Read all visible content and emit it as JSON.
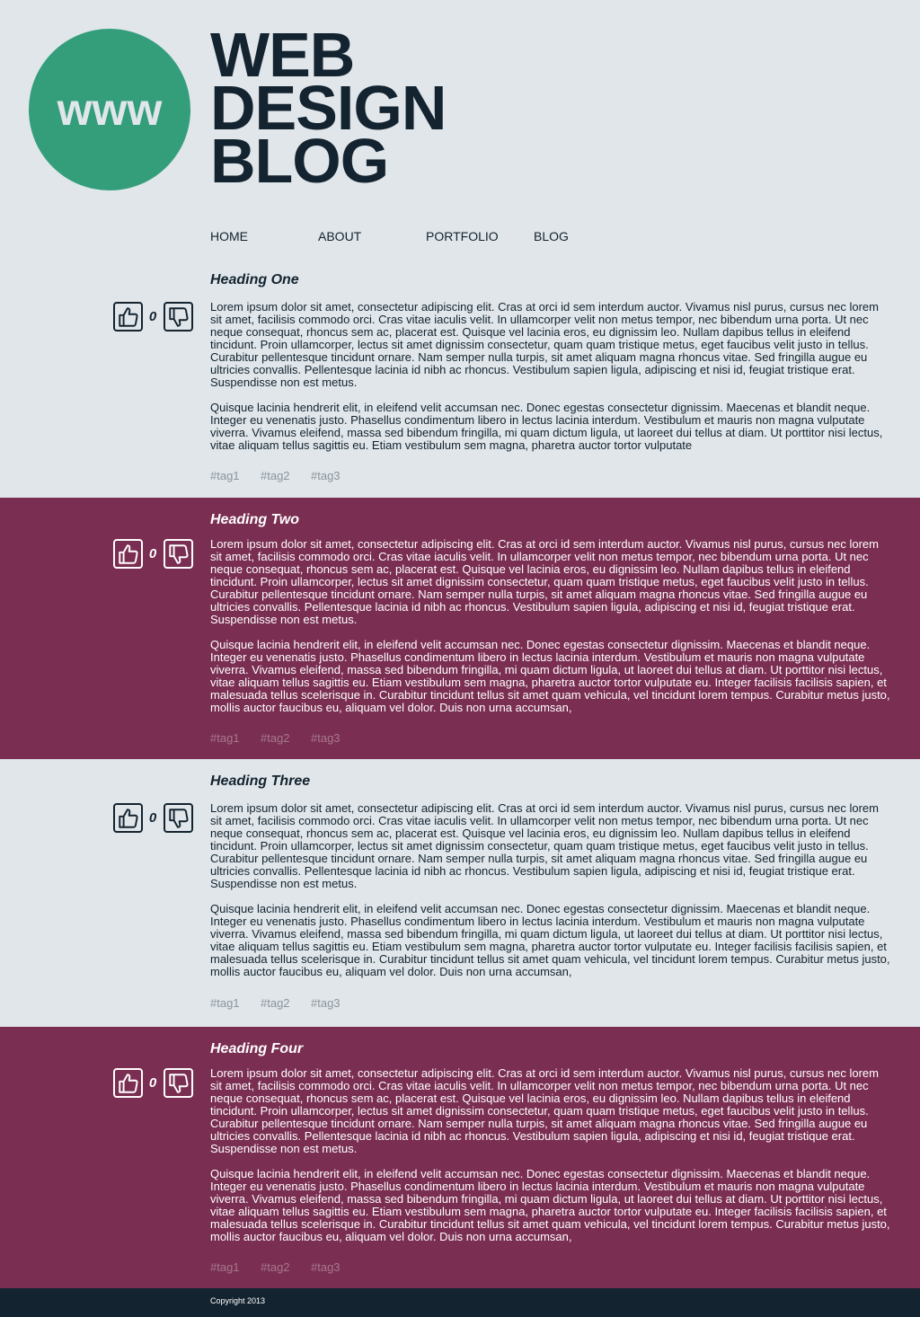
{
  "header": {
    "logo_text": "www",
    "title_lines": [
      "WEB",
      "DESIGN",
      "BLOG"
    ]
  },
  "nav": {
    "items": [
      "HOME",
      "ABOUT",
      "PORTFOLIO",
      "BLOG"
    ]
  },
  "posts": [
    {
      "heading": "Heading One",
      "votes": "0",
      "paragraphs": [
        "Lorem ipsum dolor sit amet, consectetur adipiscing elit. Cras at orci id sem interdum auctor. Vivamus nisl purus, cursus nec lorem sit amet, facilisis commodo orci. Cras vitae iaculis velit. In ullamcorper velit non metus tempor, nec bibendum urna porta. Ut nec neque consequat, rhoncus sem ac, placerat est. Quisque vel lacinia eros, eu dignissim leo. Nullam dapibus tellus in eleifend tincidunt. Proin ullamcorper, lectus sit amet dignissim consectetur, quam quam tristique metus, eget faucibus velit justo in tellus. Curabitur pellentesque tincidunt ornare. Nam semper nulla turpis, sit amet aliquam magna rhoncus vitae. Sed fringilla augue eu ultricies convallis. Pellentesque lacinia id nibh ac rhoncus. Vestibulum sapien ligula, adipiscing et nisi id, feugiat tristique erat. Suspendisse non est metus.",
        "Quisque lacinia hendrerit elit, in eleifend velit accumsan nec. Donec egestas consectetur dignissim. Maecenas et blandit neque. Integer eu venenatis justo. Phasellus condimentum libero in lectus lacinia interdum. Vestibulum et mauris non magna vulputate viverra. Vivamus eleifend, massa sed bibendum fringilla, mi quam dictum ligula, ut laoreet dui tellus at diam. Ut porttitor nisi lectus, vitae aliquam tellus sagittis eu. Etiam vestibulum sem magna, pharetra auctor tortor vulputate"
      ],
      "tags": [
        "#tag1",
        "#tag2",
        "#tag3"
      ]
    },
    {
      "heading": "Heading Two",
      "votes": "0",
      "paragraphs": [
        "Lorem ipsum dolor sit amet, consectetur adipiscing elit. Cras at orci id sem interdum auctor. Vivamus nisl purus, cursus nec lorem sit amet, facilisis commodo orci. Cras vitae iaculis velit. In ullamcorper velit non metus tempor, nec bibendum urna porta. Ut nec neque consequat, rhoncus sem ac, placerat est. Quisque vel lacinia eros, eu dignissim leo. Nullam dapibus tellus in eleifend tincidunt. Proin ullamcorper, lectus sit amet dignissim consectetur, quam quam tristique metus, eget faucibus velit justo in tellus. Curabitur pellentesque tincidunt ornare. Nam semper nulla turpis, sit amet aliquam magna rhoncus vitae. Sed fringilla augue eu ultricies convallis. Pellentesque lacinia id nibh ac rhoncus. Vestibulum sapien ligula, adipiscing et nisi id, feugiat tristique erat. Suspendisse non est metus.",
        "Quisque lacinia hendrerit elit, in eleifend velit accumsan nec. Donec egestas consectetur dignissim. Maecenas et blandit neque. Integer eu venenatis justo. Phasellus condimentum libero in lectus lacinia interdum. Vestibulum et mauris non magna vulputate viverra. Vivamus eleifend, massa sed bibendum fringilla, mi quam dictum ligula, ut laoreet dui tellus at diam. Ut porttitor nisi lectus, vitae aliquam tellus sagittis eu. Etiam vestibulum sem magna, pharetra auctor tortor vulputate eu. Integer facilisis facilisis sapien, et malesuada tellus scelerisque in. Curabitur tincidunt tellus sit amet quam vehicula, vel tincidunt lorem tempus. Curabitur metus justo, mollis auctor faucibus eu, aliquam vel dolor. Duis non urna accumsan,"
      ],
      "tags": [
        "#tag1",
        "#tag2",
        "#tag3"
      ]
    },
    {
      "heading": "Heading Three",
      "votes": "0",
      "paragraphs": [
        "Lorem ipsum dolor sit amet, consectetur adipiscing elit. Cras at orci id sem interdum auctor. Vivamus nisl purus, cursus nec lorem sit amet, facilisis commodo orci. Cras vitae iaculis velit. In ullamcorper velit non metus tempor, nec bibendum urna porta. Ut nec neque consequat, rhoncus sem ac, placerat est. Quisque vel lacinia eros, eu dignissim leo. Nullam dapibus tellus in eleifend tincidunt. Proin ullamcorper, lectus sit amet dignissim consectetur, quam quam tristique metus, eget faucibus velit justo in tellus. Curabitur pellentesque tincidunt ornare. Nam semper nulla turpis, sit amet aliquam magna rhoncus vitae. Sed fringilla augue eu ultricies convallis. Pellentesque lacinia id nibh ac rhoncus. Vestibulum sapien ligula, adipiscing et nisi id, feugiat tristique erat. Suspendisse non est metus.",
        "Quisque lacinia hendrerit elit, in eleifend velit accumsan nec. Donec egestas consectetur dignissim. Maecenas et blandit neque. Integer eu venenatis justo. Phasellus condimentum libero in lectus lacinia interdum. Vestibulum et mauris non magna vulputate viverra. Vivamus eleifend, massa sed bibendum fringilla, mi quam dictum ligula, ut laoreet dui tellus at diam. Ut porttitor nisi lectus, vitae aliquam tellus sagittis eu. Etiam vestibulum sem magna, pharetra auctor tortor vulputate eu. Integer facilisis facilisis sapien, et malesuada tellus scelerisque in. Curabitur tincidunt tellus sit amet quam vehicula, vel tincidunt lorem tempus. Curabitur metus justo, mollis auctor faucibus eu, aliquam vel dolor. Duis non urna accumsan,"
      ],
      "tags": [
        "#tag1",
        "#tag2",
        "#tag3"
      ]
    },
    {
      "heading": "Heading Four",
      "votes": "0",
      "paragraphs": [
        "Lorem ipsum dolor sit amet, consectetur adipiscing elit. Cras at orci id sem interdum auctor. Vivamus nisl purus, cursus nec lorem sit amet, facilisis commodo orci. Cras vitae iaculis velit. In ullamcorper velit non metus tempor, nec bibendum urna porta. Ut nec neque consequat, rhoncus sem ac, placerat est. Quisque vel lacinia eros, eu dignissim leo. Nullam dapibus tellus in eleifend tincidunt. Proin ullamcorper, lectus sit amet dignissim consectetur, quam quam tristique metus, eget faucibus velit justo in tellus. Curabitur pellentesque tincidunt ornare. Nam semper nulla turpis, sit amet aliquam magna rhoncus vitae. Sed fringilla augue eu ultricies convallis. Pellentesque lacinia id nibh ac rhoncus. Vestibulum sapien ligula, adipiscing et nisi id, feugiat tristique erat. Suspendisse non est metus.",
        "Quisque lacinia hendrerit elit, in eleifend velit accumsan nec. Donec egestas consectetur dignissim. Maecenas et blandit neque. Integer eu venenatis justo. Phasellus condimentum libero in lectus lacinia interdum. Vestibulum et mauris non magna vulputate viverra. Vivamus eleifend, massa sed bibendum fringilla, mi quam dictum ligula, ut laoreet dui tellus at diam. Ut porttitor nisi lectus, vitae aliquam tellus sagittis eu. Etiam vestibulum sem magna, pharetra auctor tortor vulputate eu. Integer facilisis facilisis sapien, et malesuada tellus scelerisque in. Curabitur tincidunt tellus sit amet quam vehicula, vel tincidunt lorem tempus. Curabitur metus justo, mollis auctor faucibus eu, aliquam vel dolor. Duis non urna accumsan,"
      ],
      "tags": [
        "#tag1",
        "#tag2",
        "#tag3"
      ]
    }
  ],
  "footer": {
    "copyright": "Copyright 2013"
  },
  "colors": {
    "background": "#e0e6ea",
    "accent_green": "#349e7b",
    "accent_plum": "#7a2e52",
    "navy": "#13232f"
  }
}
